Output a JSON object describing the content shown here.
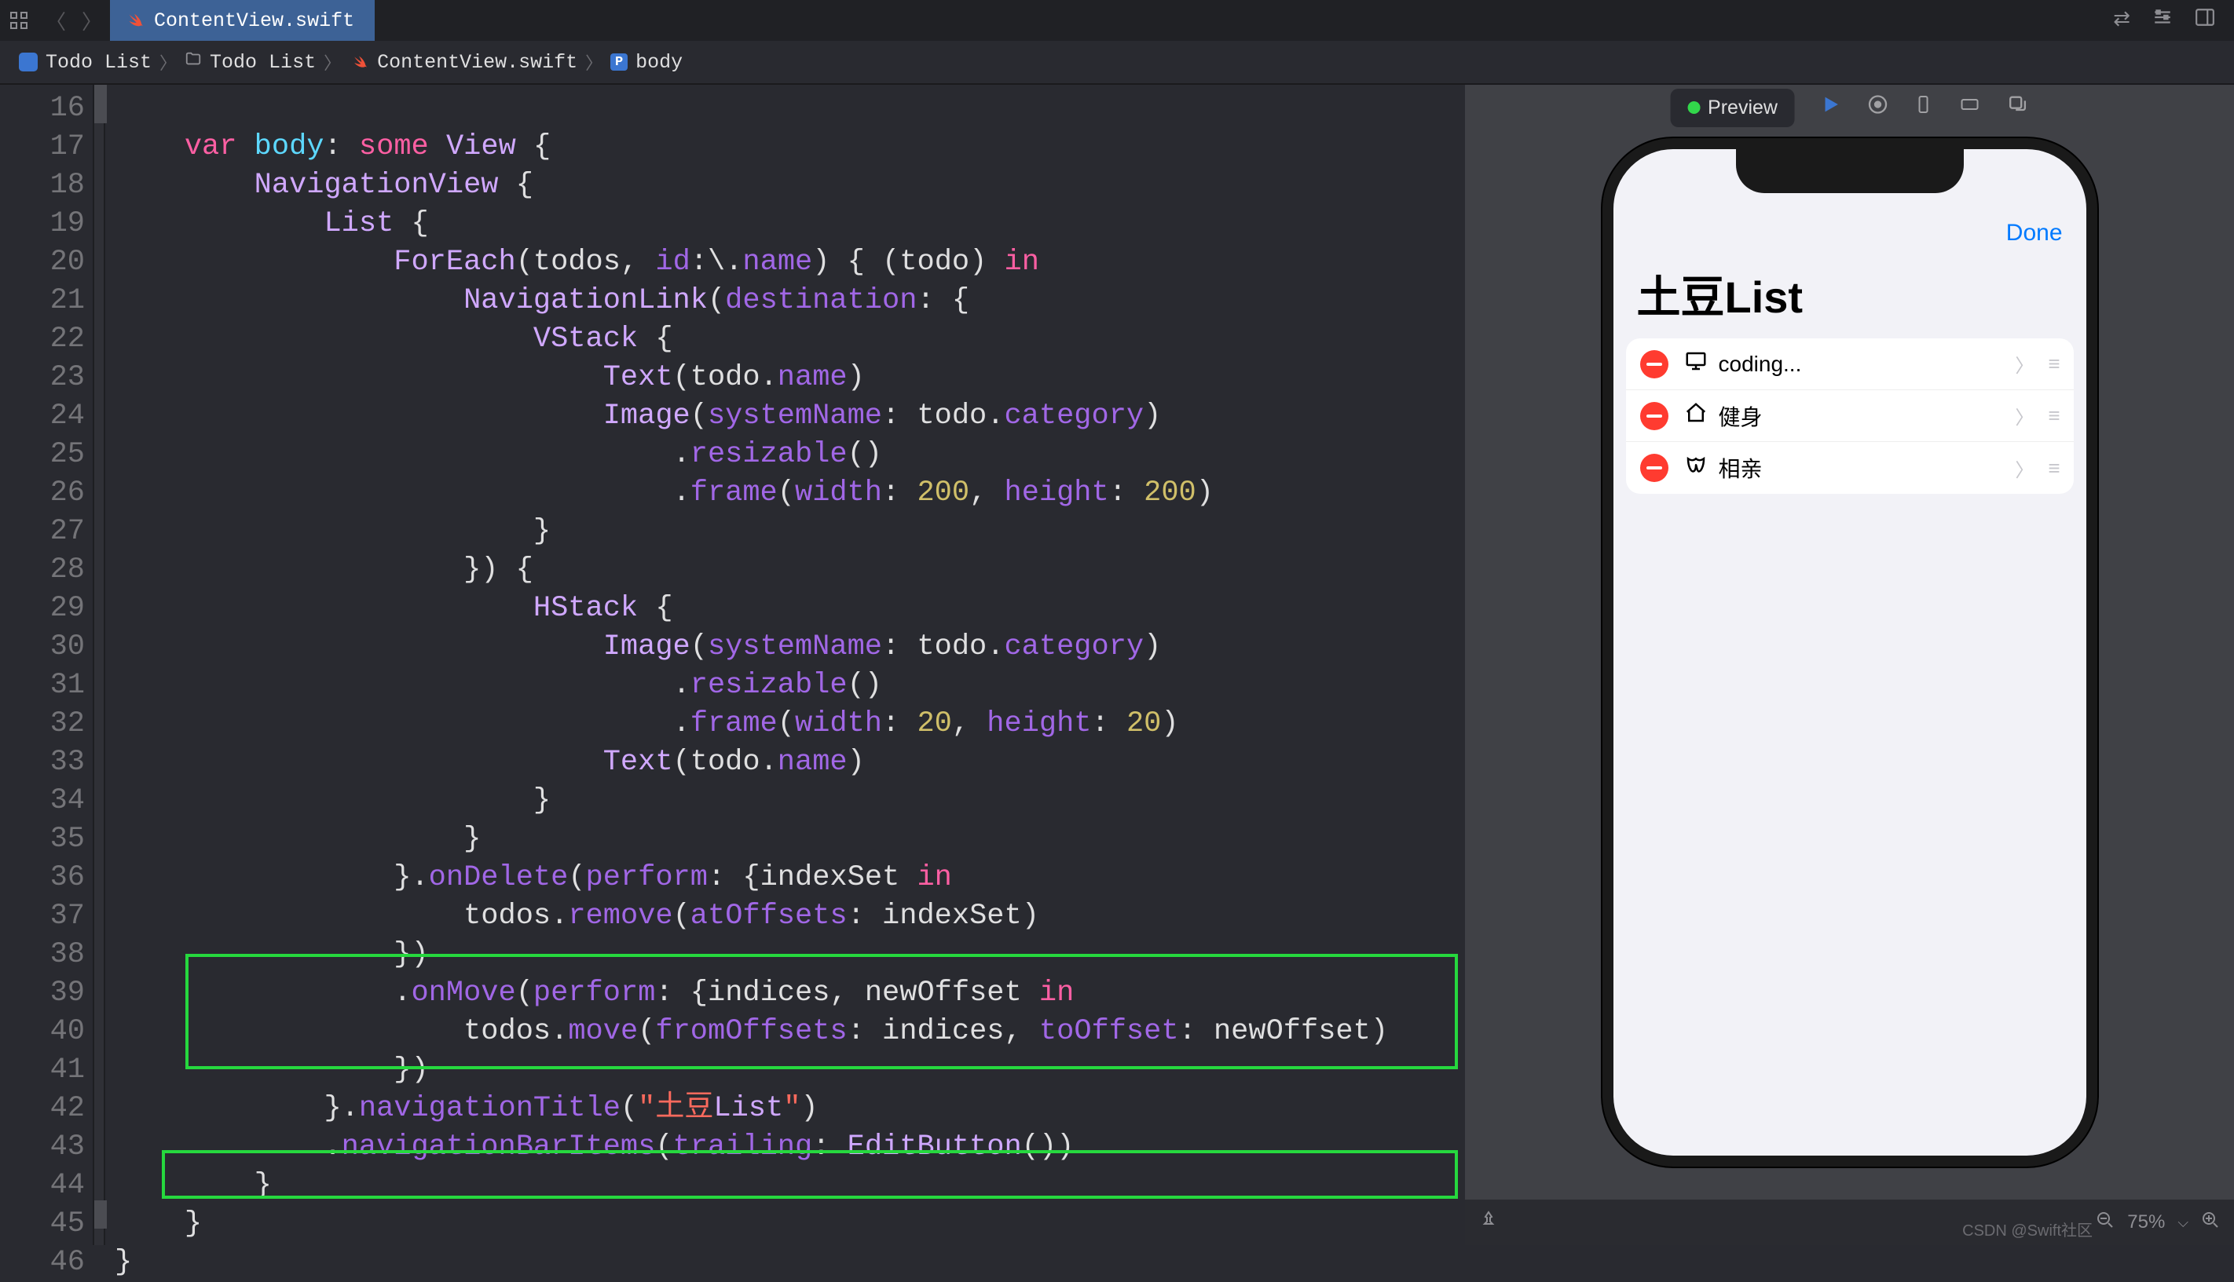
{
  "tab": {
    "filename": "ContentView.swift"
  },
  "breadcrumb": {
    "project": "Todo List",
    "folder": "Todo List",
    "file": "ContentView.swift",
    "symbol": "body"
  },
  "code": {
    "line_start": 16,
    "line_end": 46,
    "lines": [
      {
        "n": 16,
        "t": ""
      },
      {
        "n": 17,
        "t": "    var body: some View {"
      },
      {
        "n": 18,
        "t": "        NavigationView {"
      },
      {
        "n": 19,
        "t": "            List {"
      },
      {
        "n": 20,
        "t": "                ForEach(todos, id:\\.name) { (todo) in"
      },
      {
        "n": 21,
        "t": "                    NavigationLink(destination: {"
      },
      {
        "n": 22,
        "t": "                        VStack {"
      },
      {
        "n": 23,
        "t": "                            Text(todo.name)"
      },
      {
        "n": 24,
        "t": "                            Image(systemName: todo.category)"
      },
      {
        "n": 25,
        "t": "                                .resizable()"
      },
      {
        "n": 26,
        "t": "                                .frame(width: 200, height: 200)"
      },
      {
        "n": 27,
        "t": "                        }"
      },
      {
        "n": 28,
        "t": "                    }) {"
      },
      {
        "n": 29,
        "t": "                        HStack {"
      },
      {
        "n": 30,
        "t": "                            Image(systemName: todo.category)"
      },
      {
        "n": 31,
        "t": "                                .resizable()"
      },
      {
        "n": 32,
        "t": "                                .frame(width: 20, height: 20)"
      },
      {
        "n": 33,
        "t": "                            Text(todo.name)"
      },
      {
        "n": 34,
        "t": "                        }"
      },
      {
        "n": 35,
        "t": "                    }"
      },
      {
        "n": 36,
        "t": "                }.onDelete(perform: {indexSet in"
      },
      {
        "n": 37,
        "t": "                    todos.remove(atOffsets: indexSet)"
      },
      {
        "n": 38,
        "t": "                })"
      },
      {
        "n": 39,
        "t": "                .onMove(perform: {indices, newOffset in"
      },
      {
        "n": 40,
        "t": "                    todos.move(fromOffsets: indices, toOffset: newOffset)"
      },
      {
        "n": 41,
        "t": "                })"
      },
      {
        "n": 42,
        "t": "            }.navigationTitle(\"土豆List\")"
      },
      {
        "n": 43,
        "t": "            .navigationBarItems(trailing: EditButton())"
      },
      {
        "n": 44,
        "t": "        }"
      },
      {
        "n": 45,
        "t": "    }"
      },
      {
        "n": 46,
        "t": "}"
      }
    ]
  },
  "preview": {
    "toolbar_label": "Preview",
    "done_label": "Done",
    "title": "土豆List",
    "items": [
      {
        "icon": "display",
        "text": "coding..."
      },
      {
        "icon": "house",
        "text": "健身"
      },
      {
        "icon": "mask",
        "text": "相亲"
      }
    ],
    "zoom": "75%"
  },
  "watermark": "CSDN @Swift社区"
}
